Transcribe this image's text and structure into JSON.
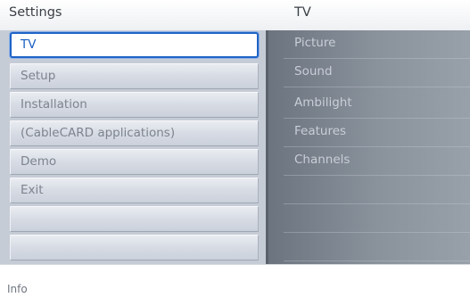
{
  "header": {
    "left_title": "Settings",
    "right_title": "TV"
  },
  "menu": {
    "selected_index": 0,
    "items": [
      {
        "label": "TV"
      },
      {
        "label": "Setup"
      },
      {
        "label": "Installation"
      },
      {
        "label": "(CableCARD applications)"
      },
      {
        "label": "Demo"
      },
      {
        "label": "Exit"
      },
      {
        "label": ""
      },
      {
        "label": ""
      }
    ]
  },
  "submenu": {
    "items": [
      {
        "label": "Picture"
      },
      {
        "label": "Sound"
      },
      {
        "label": "Ambilight"
      },
      {
        "label": "Features"
      },
      {
        "label": "Channels"
      },
      {
        "label": ""
      },
      {
        "label": ""
      },
      {
        "label": ""
      }
    ]
  },
  "info": {
    "label": "Info"
  },
  "colors": {
    "accent": "#1f63c6",
    "selected_text": "#1a5fc4",
    "menu_text": "#7d848e",
    "submenu_text": "#c9ced6"
  }
}
